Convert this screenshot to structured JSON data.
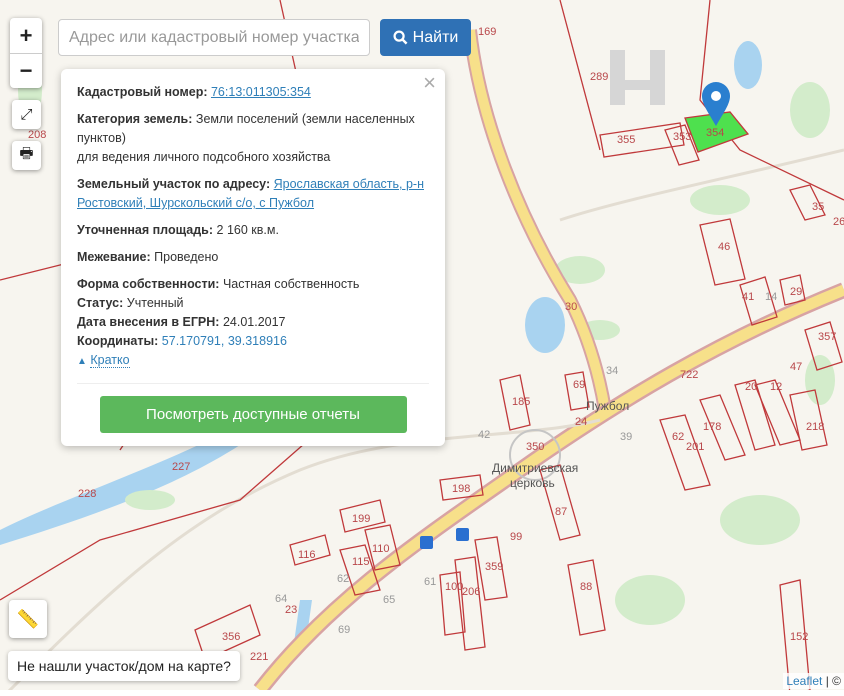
{
  "search": {
    "placeholder": "Адрес или кадастровый номер участка",
    "button_label": "Найти",
    "icon": "search-icon"
  },
  "zoom": {
    "in_label": "+",
    "out_label": "−"
  },
  "controls": {
    "fullscreen_icon": "expand-icon",
    "print_icon": "print-icon",
    "ruler_icon": "ruler-icon"
  },
  "popup": {
    "cadastral_label": "Кадастровый номер:",
    "cadastral_value": "76:13:011305:354",
    "category_label": "Категория земель:",
    "category_value": "Земли поселений (земли населенных пунктов)",
    "category_use": "для ведения личного подсобного хозяйства",
    "address_label": "Земельный участок по адресу:",
    "address_value": "Ярославская область, р-н Ростовский, Шурскольский с/о, с Пужбол",
    "area_label": "Уточненная площадь:",
    "area_value": "2 160 кв.м.",
    "survey_label": "Межевание:",
    "survey_value": "Проведено",
    "ownership_label": "Форма собственности:",
    "ownership_value": "Частная собственность",
    "status_label": "Статус:",
    "status_value": "Учтенный",
    "egrn_label": "Дата внесения в ЕГРН:",
    "egrn_value": "24.01.2017",
    "coords_label": "Координаты:",
    "coords_value": "57.170791, 39.318916",
    "brief_label": "Кратко",
    "reports_button": "Посмотреть доступные отчеты",
    "close_label": "×"
  },
  "not_found_label": "Не нашли участок/дом на карте?",
  "attribution": {
    "link": "Leaflet",
    "rest": " | ©"
  },
  "map": {
    "selected_parcel_color": "#4ee04e",
    "parcel_color": "#c0393b",
    "labels": [
      "289",
      "355",
      "353",
      "354",
      "35",
      "26",
      "46",
      "41",
      "14",
      "29",
      "357",
      "30",
      "34",
      "722",
      "20",
      "12",
      "47",
      "218",
      "178",
      "201",
      "62",
      "39",
      "24",
      "69",
      "185",
      "42",
      "350",
      "Пужбол",
      "Димитриевская",
      "церковь",
      "198",
      "199",
      "116",
      "110",
      "115",
      "62",
      "61",
      "100",
      "206",
      "359",
      "87",
      "99",
      "88",
      "64",
      "23",
      "65",
      "69",
      "356",
      "221",
      "152",
      "227",
      "228",
      "208",
      "169"
    ]
  }
}
